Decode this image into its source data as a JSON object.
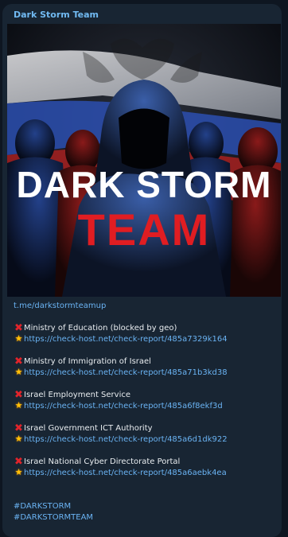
{
  "channel": {
    "title": "Dark Storm Team"
  },
  "poster": {
    "line1": "DARK STORM",
    "line2": "TEAM"
  },
  "caption": {
    "invite_link": "t.me/darkstormteamup",
    "targets": [
      {
        "name": "Ministry of Education (blocked by geo)",
        "url": "https://check-host.net/check-report/485a7329k164"
      },
      {
        "name": "Ministry of Immigration of Israel",
        "url": "https://check-host.net/check-report/485a71b3kd38"
      },
      {
        "name": "Israel Employment Service",
        "url": "https://check-host.net/check-report/485a6f8ekf3d"
      },
      {
        "name": "Israel Government ICT Authority",
        "url": "https://check-host.net/check-report/485a6d1dk922"
      },
      {
        "name": "Israel National Cyber Directorate Portal",
        "url": "https://check-host.net/check-report/485a6aebk4ea"
      }
    ],
    "hashtags": [
      "#DARKSTORM",
      "#DARKSTORMTEAM"
    ]
  },
  "icons": {
    "fail": "cross-mark-icon",
    "link": "glowing-star-icon"
  },
  "colors": {
    "bubble": "#182533",
    "background": "#0e1621",
    "link": "#6ab3f3",
    "accent_red": "#e0242b"
  }
}
